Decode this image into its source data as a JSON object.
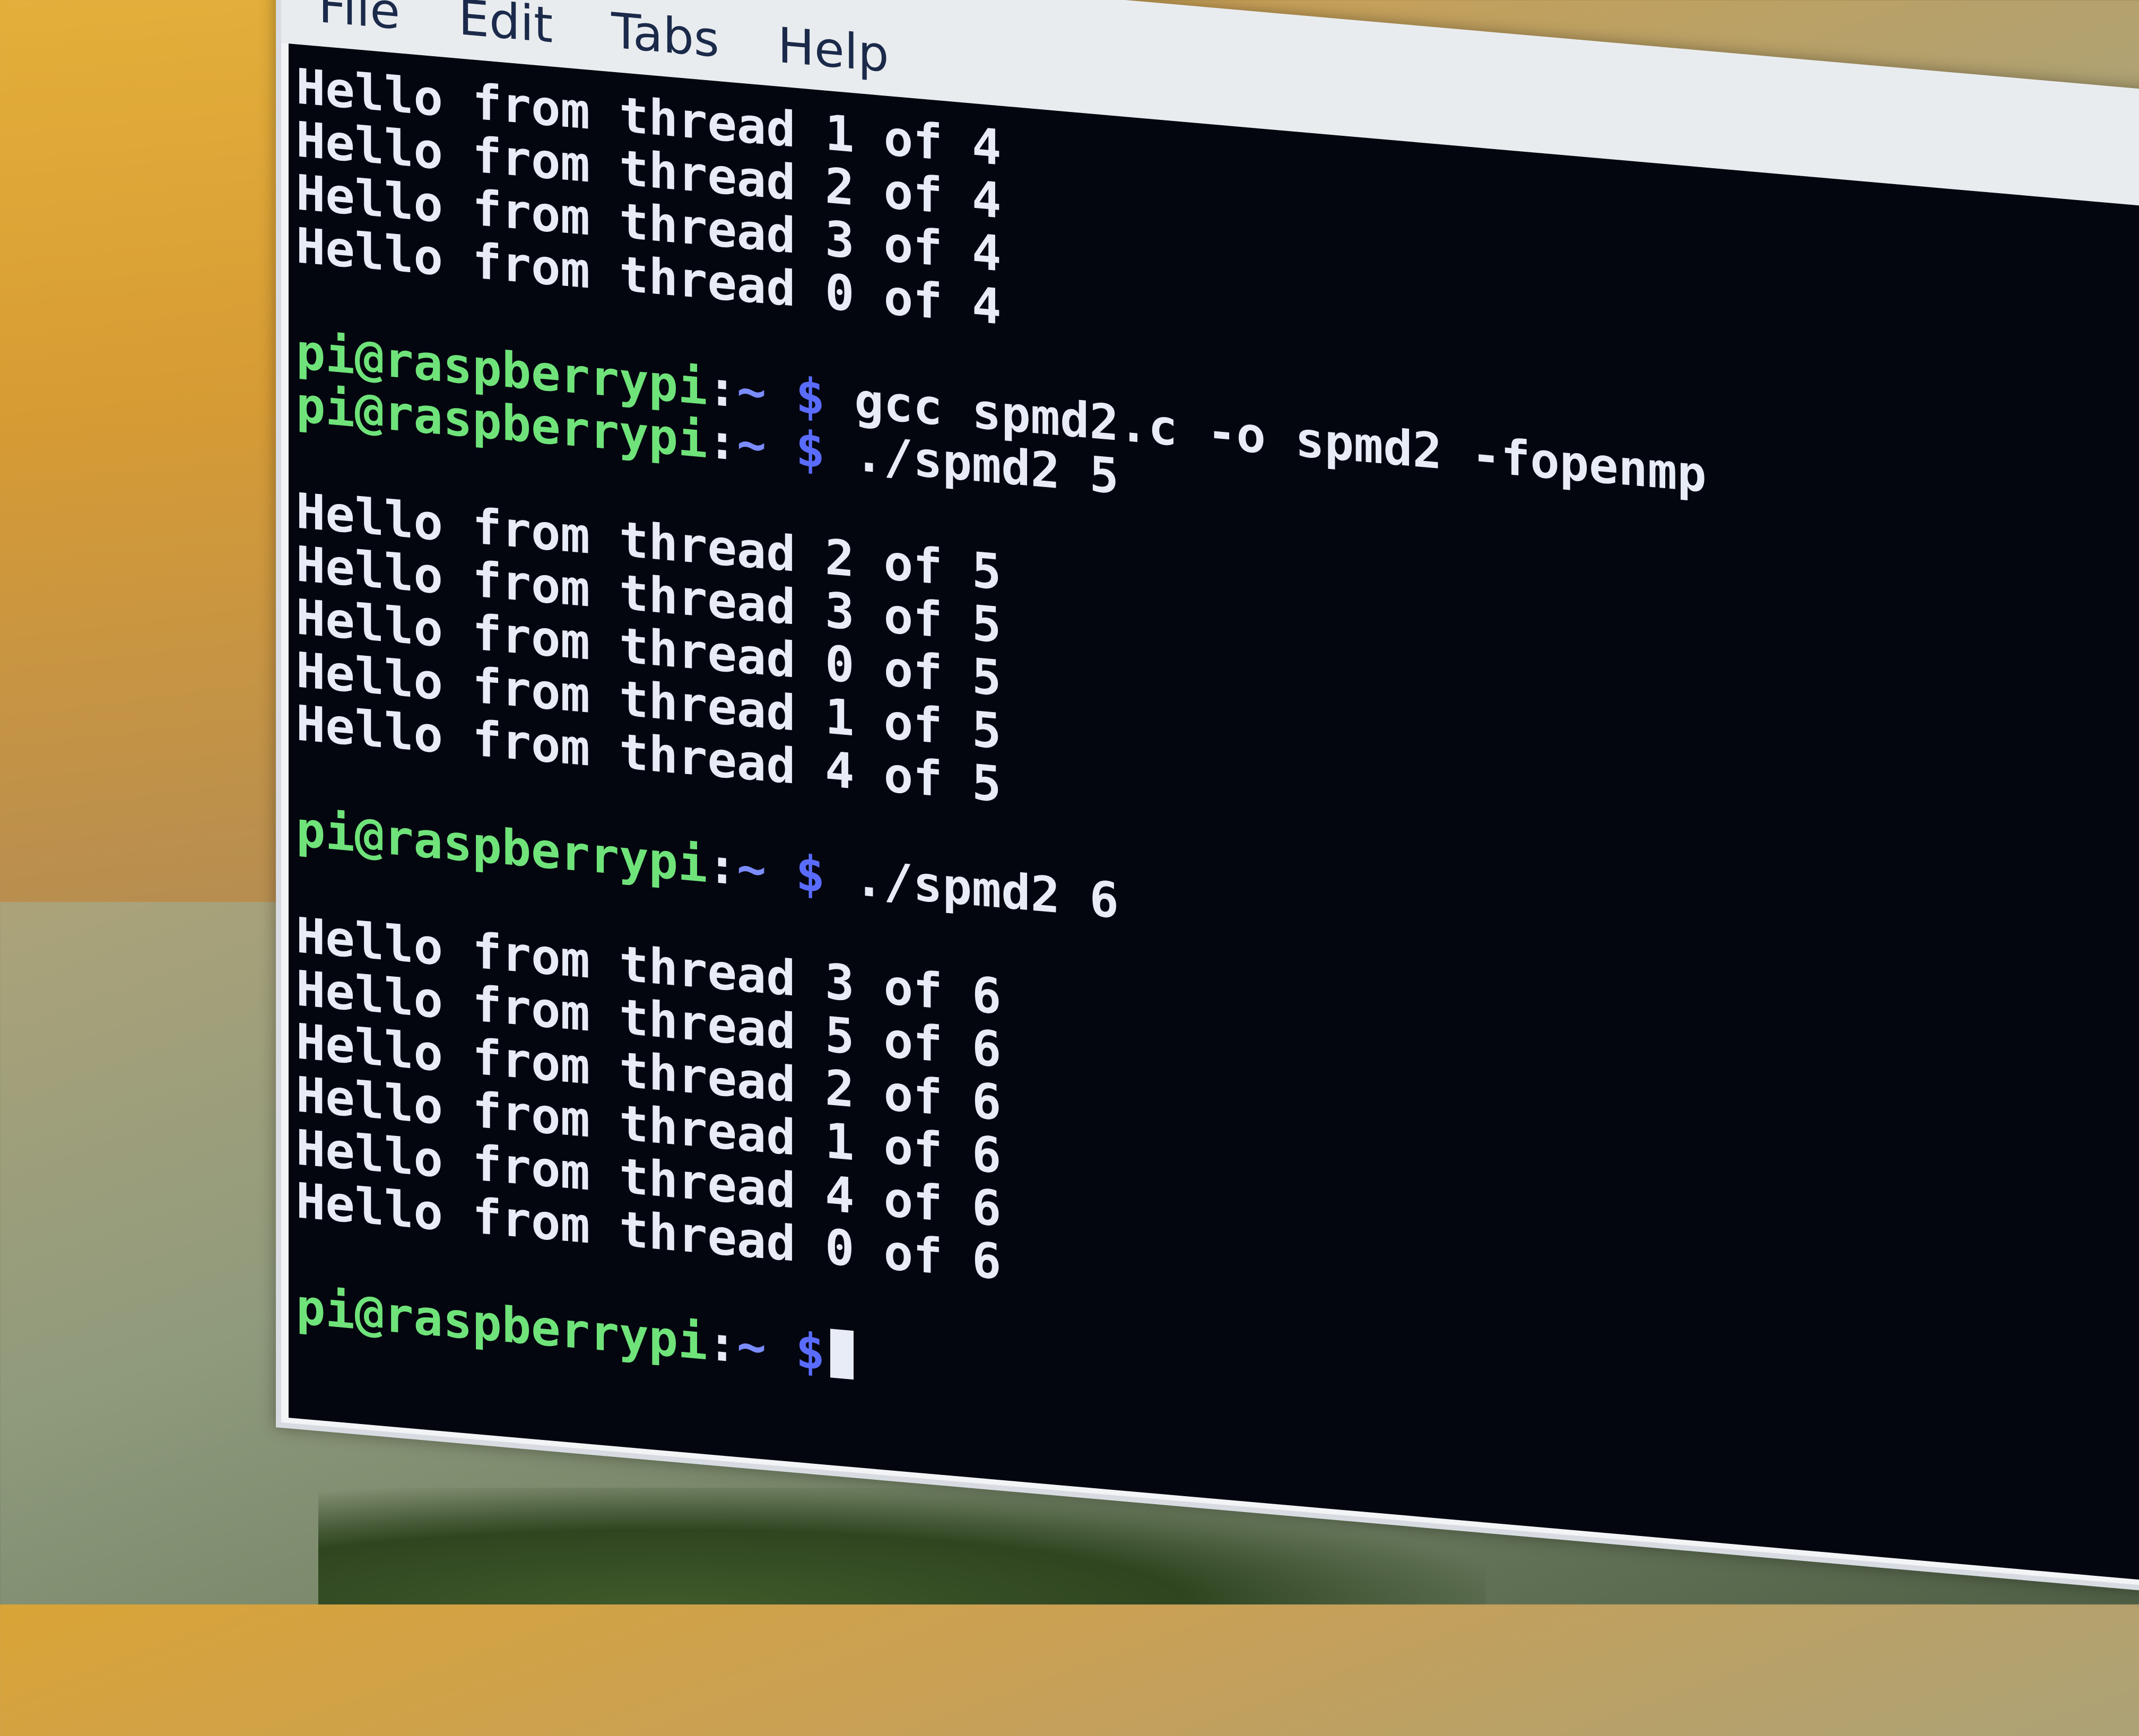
{
  "menu": [
    "File",
    "Edit",
    "Tabs",
    "Help"
  ],
  "prompt": {
    "user": "pi@raspberrypi",
    "sep": ":",
    "path": "~",
    "symbol": "$"
  },
  "terminal": {
    "block1": [
      "Hello from thread 1 of 4",
      "Hello from thread 2 of 4",
      "Hello from thread 3 of 4",
      "Hello from thread 0 of 4"
    ],
    "cmd1": "gcc spmd2.c -o spmd2 -fopenmp",
    "cmd2": "./spmd2 5",
    "block2": [
      "Hello from thread 2 of 5",
      "Hello from thread 3 of 5",
      "Hello from thread 0 of 5",
      "Hello from thread 1 of 5",
      "Hello from thread 4 of 5"
    ],
    "cmd3": "./spmd2 6",
    "block3": [
      "Hello from thread 3 of 6",
      "Hello from thread 5 of 6",
      "Hello from thread 2 of 6",
      "Hello from thread 1 of 6",
      "Hello from thread 4 of 6",
      "Hello from thread 0 of 6"
    ]
  }
}
